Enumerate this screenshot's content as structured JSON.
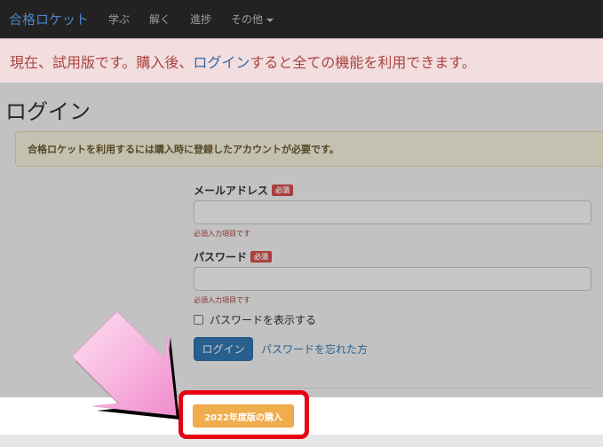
{
  "navbar": {
    "brand": "合格ロケット",
    "items": [
      {
        "label": "学ぶ"
      },
      {
        "label": "解く"
      },
      {
        "label": "進捗"
      },
      {
        "label": "その他"
      }
    ]
  },
  "trial_banner": {
    "text_before": "現在、試用版です。購入後、",
    "link": "ログイン",
    "text_after": "すると全ての機能を利用できます。"
  },
  "page": {
    "title": "ログイン",
    "info": "合格ロケットを利用するには購入時に登録したアカウントが必要です。"
  },
  "form": {
    "email_label": "メールアドレス",
    "password_label": "パスワード",
    "required_badge": "必須",
    "required_help": "必須入力項目です",
    "email_value": "",
    "password_value": "",
    "show_password_label": "パスワードを表示する",
    "login_button": "ログイン",
    "forgot_link": "パスワードを忘れた方"
  },
  "purchase": {
    "button_label": "2022年度版の購入"
  },
  "colors": {
    "highlight_frame": "#e60012",
    "arrow_pink": "#f7b3dd",
    "purchase_button": "#f0ad4e",
    "primary_button": "#337ab7"
  }
}
